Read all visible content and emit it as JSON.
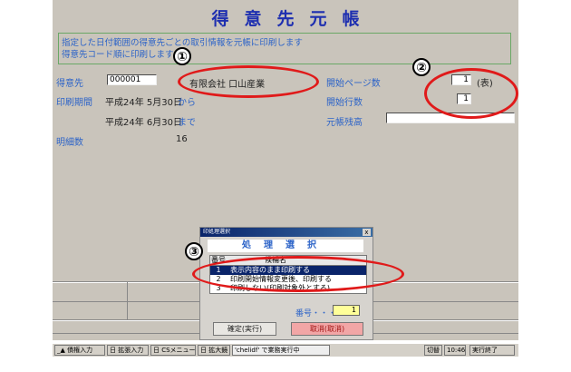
{
  "window": {
    "title": "得意先元帳",
    "info_lines": [
      "指定した日付範囲の得意先ごとの取引情報を元帳に印刷します",
      "得意先コード順に印刷します"
    ]
  },
  "form": {
    "customer_label": "得意先",
    "customer_code": "000001",
    "customer_name": "有限会社 口山産業",
    "period_label": "印刷期間",
    "period_from": "平成24年 5月30日",
    "from_label": "から",
    "period_to": "平成24年 6月30日",
    "to_label": "まで",
    "detail_count_label": "明細数",
    "detail_count": "16",
    "start_page_label": "開始ページ数",
    "start_page_value": "1",
    "start_page_suffix": "(表)",
    "start_row_label": "開始行数",
    "start_row_value": "1",
    "ledger_balance_label": "元帳残高",
    "ledger_balance_value": ""
  },
  "dialog": {
    "titlebar": "印処理選択",
    "close": "x",
    "heading": "処理選択",
    "col_no": "番号",
    "col_name": "候補名",
    "rows": [
      {
        "no": "1",
        "name": "表示内容のまま印刷する"
      },
      {
        "no": "2",
        "name": "印刷開始情報変更後、印刷する"
      },
      {
        "no": "3",
        "name": "印刷しない(印刷対象外とする)"
      }
    ],
    "number_label": "番号・・・",
    "number_value": "1",
    "ok_button": "確定(実行)",
    "cancel_button": "取消(取消)"
  },
  "markers": [
    "①",
    "②",
    "③"
  ],
  "taskbar": {
    "items": [
      "_▲ 債権入力",
      "日 拡張入力",
      "日 CSメニュー",
      "日 拡大鏡",
      "'chelidf' で業務実行中"
    ],
    "right_items": [
      "切替",
      "10:46",
      "実行終了"
    ]
  },
  "colors": {
    "window_bg": "#c9c4bb",
    "label_blue": "#2d64c8",
    "title_blue": "#1e2fb0",
    "annotation_red": "#e01a1a",
    "selected_row": "#0a246a",
    "number_field": "#ffff99"
  }
}
